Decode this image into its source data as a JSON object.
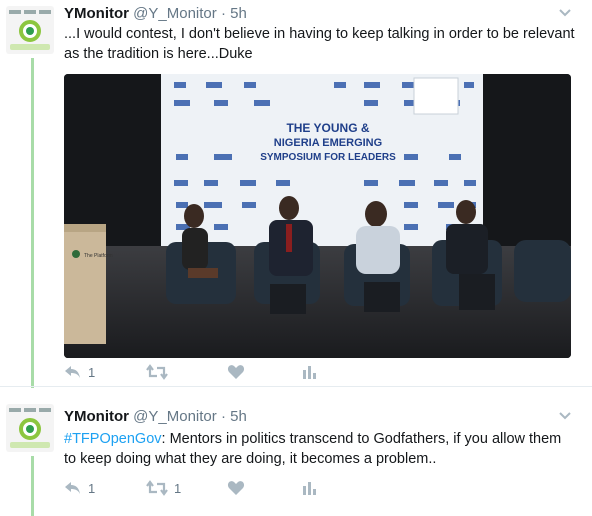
{
  "tweets": [
    {
      "author_name": "YMonitor",
      "handle": "@Y_Monitor",
      "separator": "·",
      "time": "5h",
      "text": "...I would contest, I don't believe in having to keep talking in order to be relevant as the tradition is here...Duke",
      "media": {
        "backdrop_lines": [
          "THE YOUNG &",
          "NIGERIA EMERGING",
          "SYMPOSIUM FOR LEADERS"
        ],
        "podium_label": "The Platform"
      },
      "actions": {
        "reply_count": "1",
        "retweet_count": "",
        "like_count": ""
      }
    },
    {
      "author_name": "YMonitor",
      "handle": "@Y_Monitor",
      "separator": "·",
      "time": "5h",
      "hashtag": "#TFPOpenGov",
      "text": ": Mentors in politics transcend to Godfathers, if you allow them to keep doing what they are doing, it becomes a problem..",
      "actions": {
        "reply_count": "1",
        "retweet_count": "1",
        "like_count": ""
      }
    }
  ],
  "colors": {
    "link": "#1da1f2",
    "meta": "#657786",
    "thread": "#a8dca8",
    "action_icon": "#aab8c2"
  },
  "icons": [
    "reply-icon",
    "retweet-icon",
    "like-icon",
    "analytics-icon",
    "caret-down-icon"
  ]
}
